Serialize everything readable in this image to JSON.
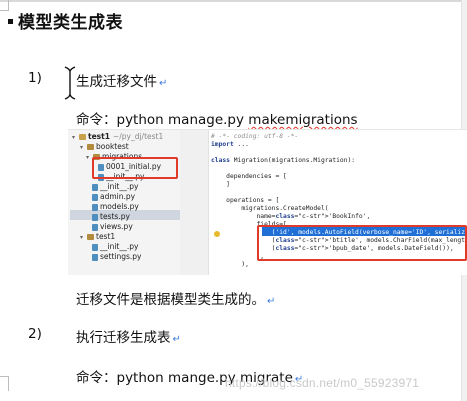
{
  "heading": "模型类生成表",
  "step1": {
    "num": "1)",
    "title": "生成迁移文件"
  },
  "cmd1": {
    "label": "命令：",
    "text_plain": "python manage.py ",
    "text_wavy": "makemigrations"
  },
  "note": "迁移文件是根据模型类生成的。",
  "step2": {
    "num": "2)",
    "title": "执行迁移生成表"
  },
  "cmd2": {
    "label": "命令：",
    "text": "python mange.py migrate"
  },
  "paragraph_mark": "↵",
  "watermark": "https://blog.csdn.net/m0_55923971",
  "ide": {
    "tree": [
      {
        "text": "test1",
        "extra": "~/py_dj/test1",
        "kind": "dir",
        "bold": true
      },
      {
        "text": "booktest",
        "kind": "pkg"
      },
      {
        "text": "migrations",
        "kind": "pkg"
      },
      {
        "text": "0001_initial.py",
        "kind": "py"
      },
      {
        "text": "__init__.py",
        "kind": "py"
      },
      {
        "text": "__init__.py",
        "kind": "py"
      },
      {
        "text": "admin.py",
        "kind": "py"
      },
      {
        "text": "models.py",
        "kind": "py",
        "selected": true
      },
      {
        "text": "tests.py",
        "kind": "py"
      },
      {
        "text": "views.py",
        "kind": "py"
      },
      {
        "text": "test1",
        "kind": "pkg"
      },
      {
        "text": "__init__.py",
        "kind": "py"
      },
      {
        "text": "settings.py",
        "kind": "py"
      }
    ],
    "code": [
      "# -*- coding: utf-8 -*-",
      "import ...",
      "",
      "class Migration(migrations.Migration):",
      "",
      "    dependencies = [",
      "    ]",
      "",
      "    operations = [",
      "        migrations.CreateModel(",
      "            name='BookInfo',",
      "            fields=[",
      "                ('id', models.AutoField(verbose_name='ID', serialize=False, a",
      "                ('btitle', models.CharField(max_length=20)),",
      "                ('bpub_date', models.DateField()),",
      "            ],",
      "        ),"
    ]
  },
  "colors": {
    "accent_red": "#e03a2a",
    "mark_blue": "#3b7be0",
    "selection_blue": "#1f6fd6"
  }
}
